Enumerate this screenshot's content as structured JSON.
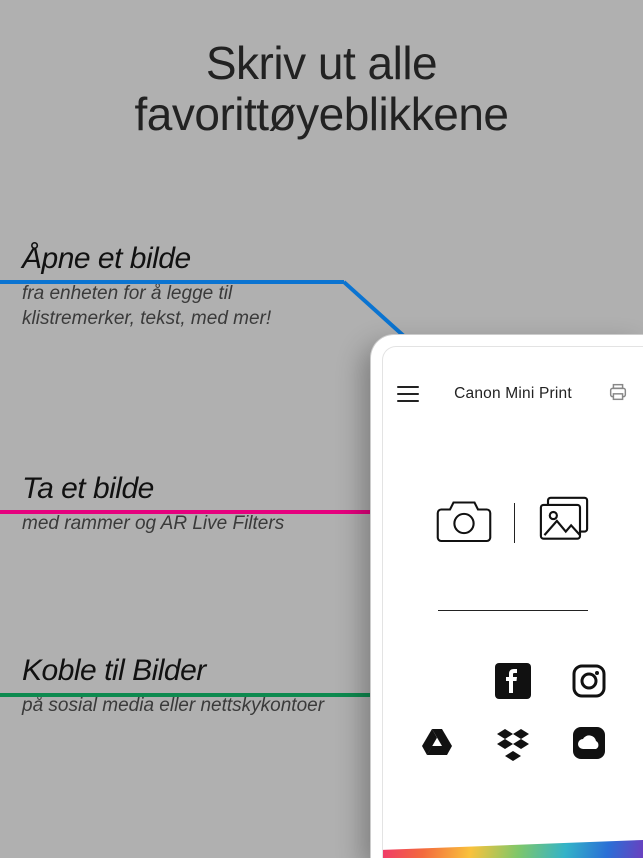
{
  "headline_line1": "Skriv ut alle",
  "headline_line2": "favorittøyeblikkene",
  "sections": {
    "open": {
      "title": "Åpne et bilde",
      "sub": "fra enheten for å legge til klistremerker, tekst, med mer!"
    },
    "take": {
      "title": "Ta et bilde",
      "sub": "med rammer og AR Live Filters"
    },
    "connect": {
      "title": "Koble til Bilder",
      "sub": "på sosial media eller nettskykontoer"
    }
  },
  "app": {
    "title": "Canon Mini Print"
  }
}
